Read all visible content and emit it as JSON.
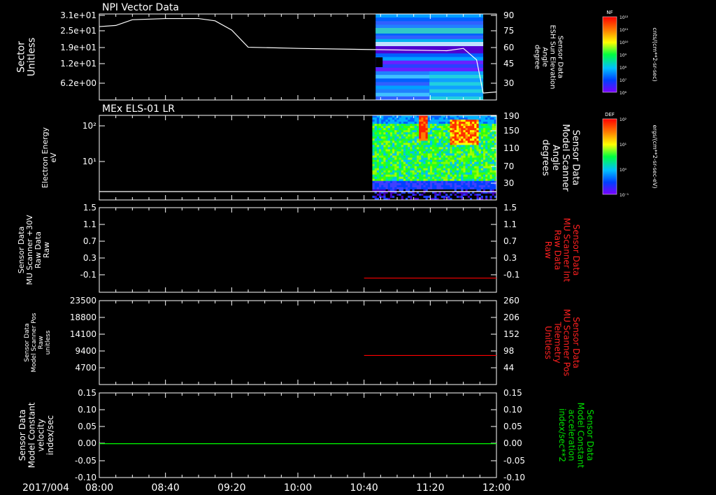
{
  "footer": {
    "date_label": "2017/004"
  },
  "time_axis": {
    "ticks": [
      "08:00",
      "08:40",
      "09:20",
      "10:00",
      "10:40",
      "11:20",
      "12:00"
    ]
  },
  "colorbars": [
    {
      "tag": "NF",
      "unit": "cnts/(cm**2-sr-sec)",
      "ticks": [
        "10¹²",
        "10¹¹",
        "10¹⁰",
        "10⁹",
        "10⁸",
        "10⁷",
        "10⁶"
      ]
    },
    {
      "tag": "DEF",
      "unit": "ergs/(cm**2-sr-sec-eV)",
      "ticks": [
        "10²",
        "10¹",
        "10⁰",
        "10⁻¹"
      ]
    }
  ],
  "chart_data": [
    {
      "type": "line",
      "title": "NPI Vector Data",
      "ylabel": [
        "Sector",
        "Unitless"
      ],
      "y_ticks": [
        "3.1e+01",
        "2.5e+01",
        "1.9e+01",
        "1.2e+01",
        "6.2e+00"
      ],
      "y2label": [
        "Sensor Data",
        "ESH Sun Elevation",
        "Angle",
        "degree"
      ],
      "y2_ticks": [
        "90",
        "75",
        "60",
        "45",
        "30"
      ],
      "y2lim": [
        15,
        90
      ],
      "series": [
        {
          "color": "#ffffff",
          "axis": "right",
          "x": [
            "08:00",
            "08:10",
            "08:20",
            "08:40",
            "09:00",
            "09:10",
            "09:20",
            "09:30",
            "10:00",
            "10:45",
            "11:30",
            "11:40",
            "11:48",
            "11:52",
            "12:00"
          ],
          "values": [
            79,
            80,
            85,
            86,
            86,
            84,
            76,
            61,
            60,
            59,
            58,
            60,
            50,
            21,
            22
          ]
        }
      ],
      "spectrogram": {
        "x_range": [
          "10:47",
          "11:52"
        ],
        "colormap": "rainbow"
      }
    },
    {
      "type": "heatmap",
      "title": "MEx ELS-01 LR",
      "ylabel": [
        "Electron Energy",
        "eV"
      ],
      "y_ticks": [
        "10²",
        "10¹"
      ],
      "y2label": [
        "Sensor Data",
        "Model Scanner",
        "Angle",
        "degrees"
      ],
      "y2_ticks": [
        "190",
        "150",
        "110",
        "70",
        "30"
      ],
      "x_range": [
        "10:45",
        "12:00"
      ],
      "series": [
        {
          "color": "#ffffff",
          "axis": "right",
          "x": [
            "08:00",
            "12:00"
          ],
          "values": [
            3,
            3
          ]
        }
      ]
    },
    {
      "type": "line",
      "ylabel": [
        "Sensor Data",
        "MU Scanner +30V",
        "Raw Data",
        "Raw"
      ],
      "y_ticks": [
        "1.5",
        "1.1",
        "0.7",
        "0.3",
        "-0.1"
      ],
      "y2label": [
        "Sensor Data",
        "MU Scanner Int",
        "Raw Data",
        "Raw"
      ],
      "y2_ticks": [
        "1.5",
        "1.1",
        "0.7",
        "0.3",
        "-0.1"
      ],
      "ylim": [
        -0.3,
        1.5
      ],
      "series": [
        {
          "color": "#ff0000",
          "x": [
            "10:40",
            "12:00"
          ],
          "values": [
            0,
            0
          ]
        }
      ]
    },
    {
      "type": "line",
      "ylabel": [
        "Sensor Data",
        "Model Scanner Pos",
        "Raw",
        "unitless"
      ],
      "y_ticks": [
        "23500",
        "18800",
        "14100",
        "9400",
        "4700"
      ],
      "y2label": [
        "Sensor Data",
        "MU Scanner Pos",
        "Telemetry",
        "Unitless"
      ],
      "y2_ticks": [
        "260",
        "206",
        "152",
        "98",
        "44"
      ],
      "y2lim": [
        0,
        260
      ],
      "series": [
        {
          "color": "#ff0000",
          "axis": "right",
          "x": [
            "10:40",
            "12:00"
          ],
          "values": [
            90,
            90
          ]
        }
      ]
    },
    {
      "type": "line",
      "ylabel": [
        "Sensor Data",
        "Model Constant",
        "velocity",
        "index/sec"
      ],
      "y_ticks": [
        "0.15",
        "0.10",
        "0.05",
        "0.00",
        "-0.05",
        "-0.10"
      ],
      "y2label": [
        "Sensor Data",
        "Model Constant",
        "acceleration",
        "index/sec**2"
      ],
      "y2_ticks": [
        "0.15",
        "0.10",
        "0.05",
        "0.00",
        "-0.05",
        "-0.10"
      ],
      "ylim": [
        -0.1,
        0.15
      ],
      "series": [
        {
          "color": "#00ff00",
          "x": [
            "08:00",
            "12:00"
          ],
          "values": [
            0,
            0
          ]
        }
      ]
    }
  ]
}
